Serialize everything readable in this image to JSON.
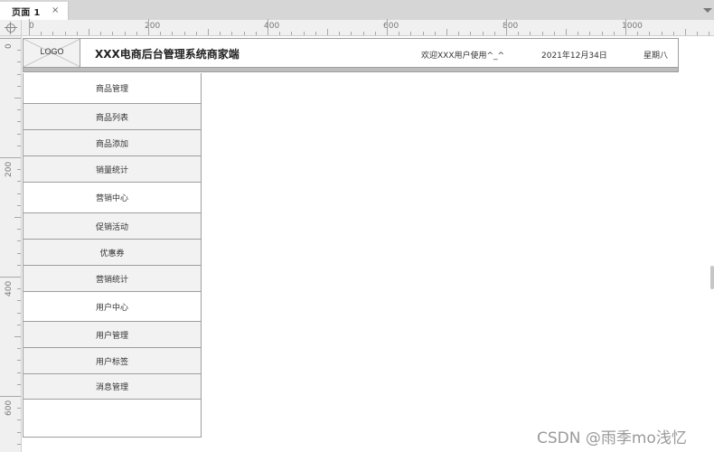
{
  "tabs": [
    {
      "label": "页面 1",
      "close_symbol": "×"
    }
  ],
  "ruler": {
    "horizontal_labels": [
      "0",
      "200",
      "400",
      "600",
      "800",
      "1000"
    ],
    "vertical_labels": [
      "0",
      "200",
      "400",
      "600"
    ]
  },
  "header": {
    "logo_label": "LOGO",
    "title": "XXX电商后台管理系统商家端",
    "welcome": "欢迎XXX用户使用^_^",
    "date": "2021年12月34日",
    "weekday": "星期八"
  },
  "sidebar": {
    "items": [
      {
        "label": "商品管理",
        "kind": "group"
      },
      {
        "label": "商品列表",
        "kind": "sub"
      },
      {
        "label": "商品添加",
        "kind": "sub"
      },
      {
        "label": "销量统计",
        "kind": "sub"
      },
      {
        "label": "营销中心",
        "kind": "group"
      },
      {
        "label": "促销活动",
        "kind": "sub"
      },
      {
        "label": "优惠券",
        "kind": "sub"
      },
      {
        "label": "营销统计",
        "kind": "sub"
      },
      {
        "label": "用户中心",
        "kind": "group"
      },
      {
        "label": "用户管理",
        "kind": "sub"
      },
      {
        "label": "用户标签",
        "kind": "sub"
      },
      {
        "label": "消息管理",
        "kind": "sub"
      }
    ]
  },
  "watermark": "CSDN @雨季mo浅忆",
  "icons": {
    "tab_close": "close-icon",
    "tab_menu": "chevron-down-icon",
    "ruler_origin": "crosshair-icon",
    "logo_placeholder": "image-placeholder-icon"
  },
  "colors": {
    "border": "#9e9e9e",
    "submenu_background": "#f2f2f2",
    "header_bar": "#bdbdbd"
  }
}
